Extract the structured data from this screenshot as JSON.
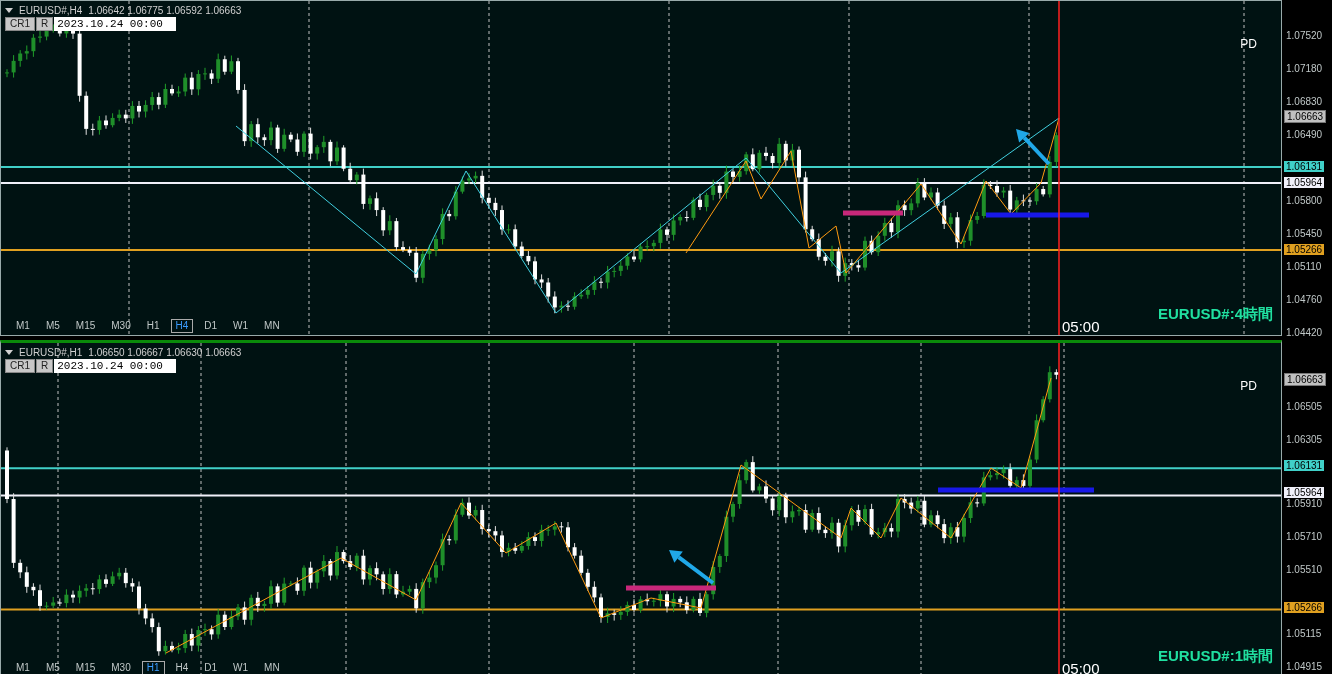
{
  "panels": [
    {
      "active": false,
      "symbol": "EURUSD#,H4",
      "quote": "1.06642 1.06775 1.06592 1.06663",
      "buttons": [
        "CR1",
        "R"
      ],
      "date": "2023.10.24 00:00",
      "marker": "PD",
      "axis_ticks": [
        "1.07520",
        "1.07180",
        "1.06830",
        "1.06490",
        "1.05800",
        "1.05450",
        "1.05110",
        "1.04760",
        "1.04420"
      ],
      "price_labels": [
        {
          "value": "1.06663",
          "kind": "bid",
          "color": "#c0c0c0"
        },
        {
          "value": "1.06131",
          "kind": "line",
          "color": "#40d0c8"
        },
        {
          "value": "1.05964",
          "kind": "line",
          "color": "#f0f0fa"
        },
        {
          "value": "1.05266",
          "kind": "line",
          "color": "#e0a020"
        }
      ],
      "timeframes": [
        {
          "label": "M1",
          "selected": false
        },
        {
          "label": "M5",
          "selected": false
        },
        {
          "label": "M15",
          "selected": false
        },
        {
          "label": "M30",
          "selected": false
        },
        {
          "label": "H1",
          "selected": false
        },
        {
          "label": "H4",
          "selected": true
        },
        {
          "label": "D1",
          "selected": false
        },
        {
          "label": "W1",
          "selected": false
        },
        {
          "label": "MN",
          "selected": false
        }
      ],
      "time_label": "05:00",
      "caption": "EURUSD#:4時間"
    },
    {
      "active": true,
      "symbol": "EURUSD#,H1",
      "quote": "1.06650 1.06667 1.06630 1.06663",
      "buttons": [
        "CR1",
        "R"
      ],
      "date": "2023.10.24 00:00",
      "marker": "PD",
      "axis_ticks": [
        "1.06505",
        "1.06305",
        "1.05910",
        "1.05710",
        "1.05510",
        "1.05115",
        "1.04915"
      ],
      "price_labels": [
        {
          "value": "1.06663",
          "kind": "bid",
          "color": "#c0c0c0"
        },
        {
          "value": "1.06131",
          "kind": "line",
          "color": "#40d0c8"
        },
        {
          "value": "1.05964",
          "kind": "line",
          "color": "#f0f0fa"
        },
        {
          "value": "1.05266",
          "kind": "line",
          "color": "#e0a020"
        }
      ],
      "timeframes": [
        {
          "label": "M1",
          "selected": false
        },
        {
          "label": "M5",
          "selected": false
        },
        {
          "label": "M15",
          "selected": false
        },
        {
          "label": "M30",
          "selected": false
        },
        {
          "label": "H1",
          "selected": true
        },
        {
          "label": "H4",
          "selected": false
        },
        {
          "label": "D1",
          "selected": false
        },
        {
          "label": "W1",
          "selected": false
        },
        {
          "label": "MN",
          "selected": false
        }
      ],
      "time_label": "05:00",
      "caption": "EURUSD#:1時間"
    }
  ]
}
